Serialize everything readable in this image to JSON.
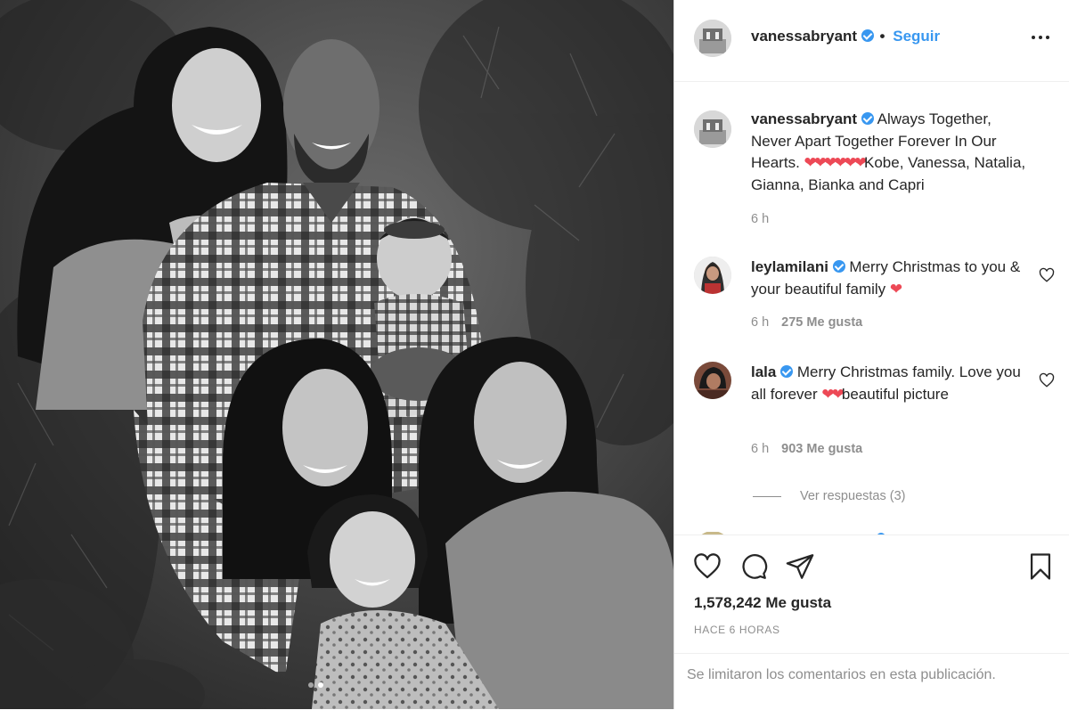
{
  "header": {
    "username": "vanessabryant",
    "separator": "•",
    "follow_label": "Seguir"
  },
  "caption": {
    "username": "vanessabryant",
    "text_before_hearts": "Always Together, Never Apart Together Forever In Our Hearts. ",
    "hearts": "❤❤❤❤❤❤",
    "text_after_hearts": "Kobe, Vanessa, Natalia, Gianna, Bianka and Capri",
    "time": "6 h"
  },
  "comments": [
    {
      "username": "leylamilani",
      "text": "Merry Christmas to you & your beautiful family ",
      "hearts": "❤",
      "text_after": "",
      "time": "6 h",
      "likes": "275 Me gusta"
    },
    {
      "username": "lala",
      "text": "Merry Christmas family. Love you all forever ",
      "hearts": "❤❤",
      "text_after": "beautiful picture",
      "time": "6 h",
      "likes": "903 Me gusta"
    }
  ],
  "replies_label": "Ver respuestas (3)",
  "actions": {
    "like_icon": "heart-outline-icon",
    "comment_icon": "comment-bubble-icon",
    "share_icon": "paper-plane-icon",
    "save_icon": "bookmark-icon"
  },
  "likes_count": "1,578,242 Me gusta",
  "time_ago": "HACE 6 HORAS",
  "comments_limited": "Se limitaron los comentarios en esta publicación.",
  "colors": {
    "accent": "#3897f0",
    "heart": "#ed4956",
    "muted": "#8e8e8e",
    "text": "#262626"
  }
}
